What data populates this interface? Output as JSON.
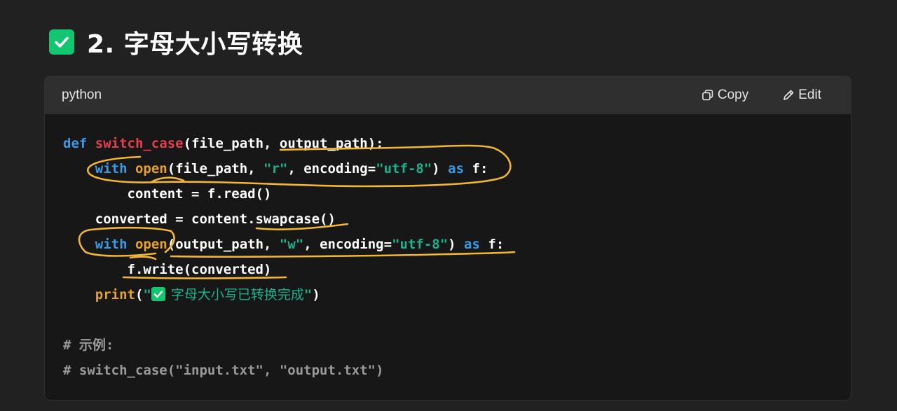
{
  "heading": {
    "icon": "check-box-icon",
    "title": "2. 字母大小写转换"
  },
  "code_block": {
    "language": "python",
    "copy_label": "Copy",
    "edit_label": "Edit",
    "copy_icon": "copy-icon",
    "edit_icon": "pencil-icon"
  },
  "code": {
    "l1": {
      "kw": "def",
      "name": "switch_case",
      "rest": "(file_path, output_path):"
    },
    "l2": {
      "kw": "with",
      "fn": "open",
      "a": "(file_path, ",
      "s1": "\"r\"",
      "b": ", encoding=",
      "s2": "\"utf-8\"",
      "c": ") ",
      "as": "as",
      "d": " f:"
    },
    "l3": {
      "text": "content = f.read()"
    },
    "l4": {
      "text": "converted = content.swapcase()"
    },
    "l5": {
      "kw": "with",
      "fn": "open",
      "a": "(output_path, ",
      "s1": "\"w\"",
      "b": ", encoding=",
      "s2": "\"utf-8\"",
      "c": ") ",
      "as": "as",
      "d": " f:"
    },
    "l6": {
      "text": "f.write(converted)"
    },
    "l7": {
      "fn": "print",
      "open": "(",
      "q1": "\"",
      "msg": "字母大小写已转换完成",
      "q2": "\"",
      "close": ")"
    },
    "l9": {
      "text": "# 示例:"
    },
    "l10": {
      "text": "# switch_case(\"input.txt\", \"output.txt\")"
    }
  },
  "colors": {
    "background": "#212121",
    "code_bg": "#171717",
    "header_bg": "#2f2f2f",
    "keyword": "#3b9ae6",
    "function_name": "#e63e4d",
    "builtin": "#e8a22b",
    "string": "#1cb08a",
    "comment": "#9a9a9a",
    "check_green": "#13c672",
    "annotation": "#f2b636"
  }
}
